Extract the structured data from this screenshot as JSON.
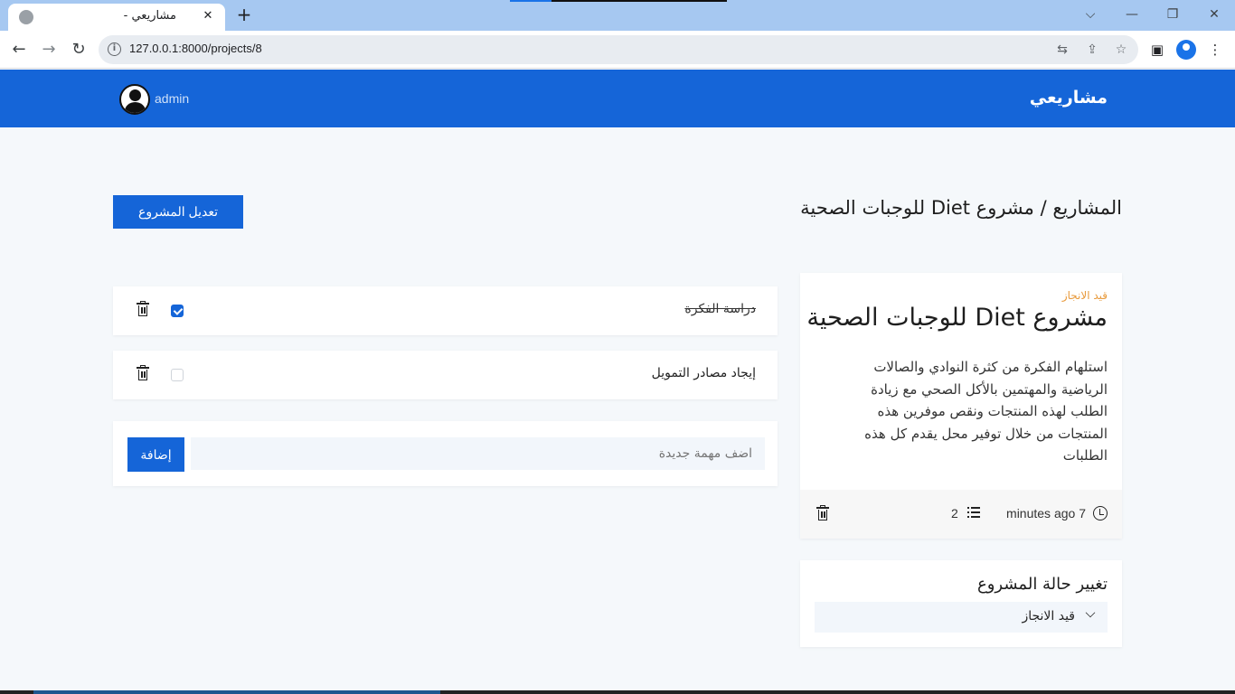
{
  "browser": {
    "tab_title": "مشاريعي -",
    "tab_close": "✕",
    "new_tab": "+",
    "url": "127.0.0.1:8000/projects/8",
    "controls": {
      "dropdown": "⌵",
      "minimize": "—",
      "restore": "❐",
      "close": "✕"
    }
  },
  "navbar": {
    "brand": "مشاريعي",
    "username": "admin"
  },
  "header": {
    "breadcrumb": "المشاريع / مشروع Diet للوجبات الصحية",
    "edit_button": "تعديل المشروع"
  },
  "project": {
    "status": "قيد الانجاز",
    "title": "مشروع Diet للوجبات الصحية",
    "description": "استلهام الفكرة من كثرة النوادي والصالات الرياضية والمهتمين بالأكل الصحي مع زيادة الطلب لهذه المنتجات ونقص موفرين هذه المنتجات من خلال توفير محل يقدم كل هذه الطلبات",
    "time": "7 minutes ago",
    "task_count": "2"
  },
  "status_panel": {
    "heading": "تغيير حالة المشروع",
    "selected": "قيد الانجاز"
  },
  "tasks": [
    {
      "text": "دراسة الفكرة",
      "done": true
    },
    {
      "text": "إيجاد مصادر التمويل",
      "done": false
    }
  ],
  "new_task": {
    "placeholder": "اضف مهمة جديدة",
    "add_button": "إضافة"
  },
  "colors": {
    "primary": "#1565d8",
    "status": "#e89a3c",
    "background": "#f5f8fb"
  }
}
